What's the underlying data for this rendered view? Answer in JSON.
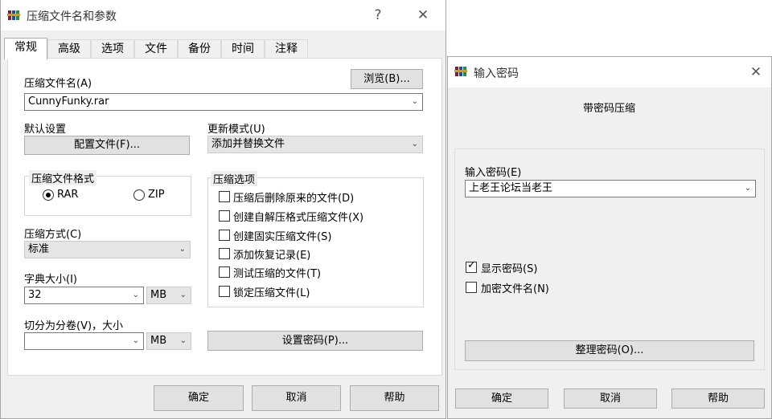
{
  "background_fragment": "",
  "main_dialog": {
    "title": "压缩文件名和参数",
    "help_glyph": "?",
    "close_glyph": "✕",
    "tabs": [
      {
        "label": "常规",
        "active": true
      },
      {
        "label": "高级",
        "active": false
      },
      {
        "label": "选项",
        "active": false
      },
      {
        "label": "文件",
        "active": false
      },
      {
        "label": "备份",
        "active": false
      },
      {
        "label": "时间",
        "active": false
      },
      {
        "label": "注释",
        "active": false
      }
    ],
    "archive_name_label": "压缩文件名(A)",
    "browse_button": "浏览(B)...",
    "archive_name_value": "CunnyFunky.rar",
    "default_settings_label": "默认设置",
    "profiles_button": "配置文件(F)...",
    "update_mode_label": "更新模式(U)",
    "update_mode_value": "添加并替换文件",
    "format_group_label": "压缩文件格式",
    "format_rar": "RAR",
    "format_zip": "ZIP",
    "selected_format": "RAR",
    "method_label": "压缩方式(C)",
    "method_value": "标准",
    "dict_label": "字典大小(I)",
    "dict_value": "32",
    "dict_unit": "MB",
    "split_label": "切分为分卷(V)，大小",
    "split_value": "",
    "split_unit": "MB",
    "options_group_label": "压缩选项",
    "options": [
      {
        "label": "压缩后删除原来的文件(D)",
        "checked": false
      },
      {
        "label": "创建自解压格式压缩文件(X)",
        "checked": false
      },
      {
        "label": "创建固实压缩文件(S)",
        "checked": false
      },
      {
        "label": "添加恢复记录(E)",
        "checked": false
      },
      {
        "label": "测试压缩的文件(T)",
        "checked": false
      },
      {
        "label": "锁定压缩文件(L)",
        "checked": false
      }
    ],
    "set_password_button": "设置密码(P)...",
    "ok_button": "确定",
    "cancel_button": "取消",
    "help_button": "帮助"
  },
  "password_dialog": {
    "title": "输入密码",
    "close_glyph": "✕",
    "heading": "带密码压缩",
    "enter_password_label": "输入密码(E)",
    "password_value": "上老王论坛当老王",
    "show_password_label": "显示密码(S)",
    "show_password_checked": true,
    "encrypt_names_label": "加密文件名(N)",
    "encrypt_names_checked": false,
    "organize_button": "整理密码(O)...",
    "ok_button": "确定",
    "cancel_button": "取消",
    "help_button": "帮助"
  },
  "colors": {
    "dialog_bg": "#f0f0f0",
    "titlebar_bg": "#ffffff",
    "button_bg": "#e1e1e1",
    "button_border": "#adadad"
  },
  "icons": {
    "app": "winrar-books-icon",
    "dropdown": "chevron-down-icon",
    "close": "close-icon",
    "help": "help-question-icon",
    "check": "check-mark-icon"
  }
}
